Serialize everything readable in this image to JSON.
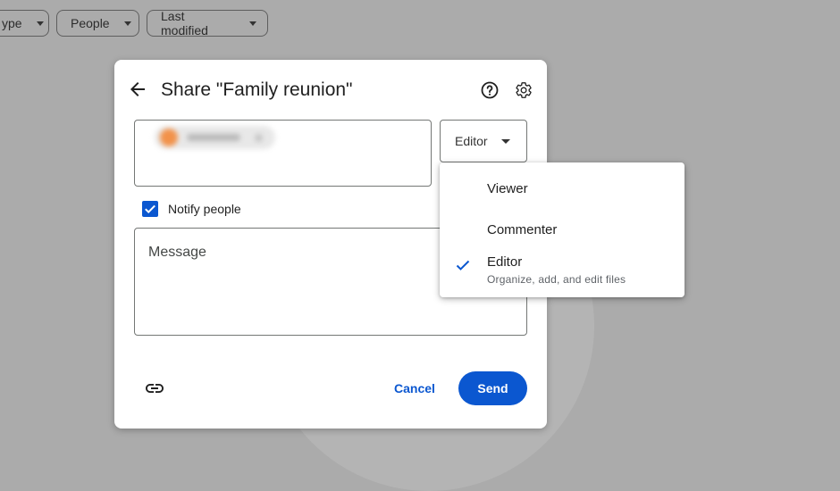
{
  "filter_bar": {
    "type_label": "ype",
    "people_label": "People",
    "modified_label": "Last modified"
  },
  "share_dialog": {
    "title": "Share \"Family reunion\"",
    "role_selected": "Editor",
    "notify_label": "Notify people",
    "notify_checked": true,
    "message_placeholder": "Message",
    "cancel_label": "Cancel",
    "send_label": "Send",
    "icons": [
      "arrow-back-icon",
      "help-icon",
      "gear-icon",
      "link-icon"
    ]
  },
  "role_menu": {
    "items": [
      {
        "label": "Viewer",
        "description": "",
        "selected": false
      },
      {
        "label": "Commenter",
        "description": "",
        "selected": false
      },
      {
        "label": "Editor",
        "description": "Organize, add, and edit files",
        "selected": true
      }
    ]
  },
  "colors": {
    "accent": "#0b57d0",
    "scrim": "#ababab"
  }
}
